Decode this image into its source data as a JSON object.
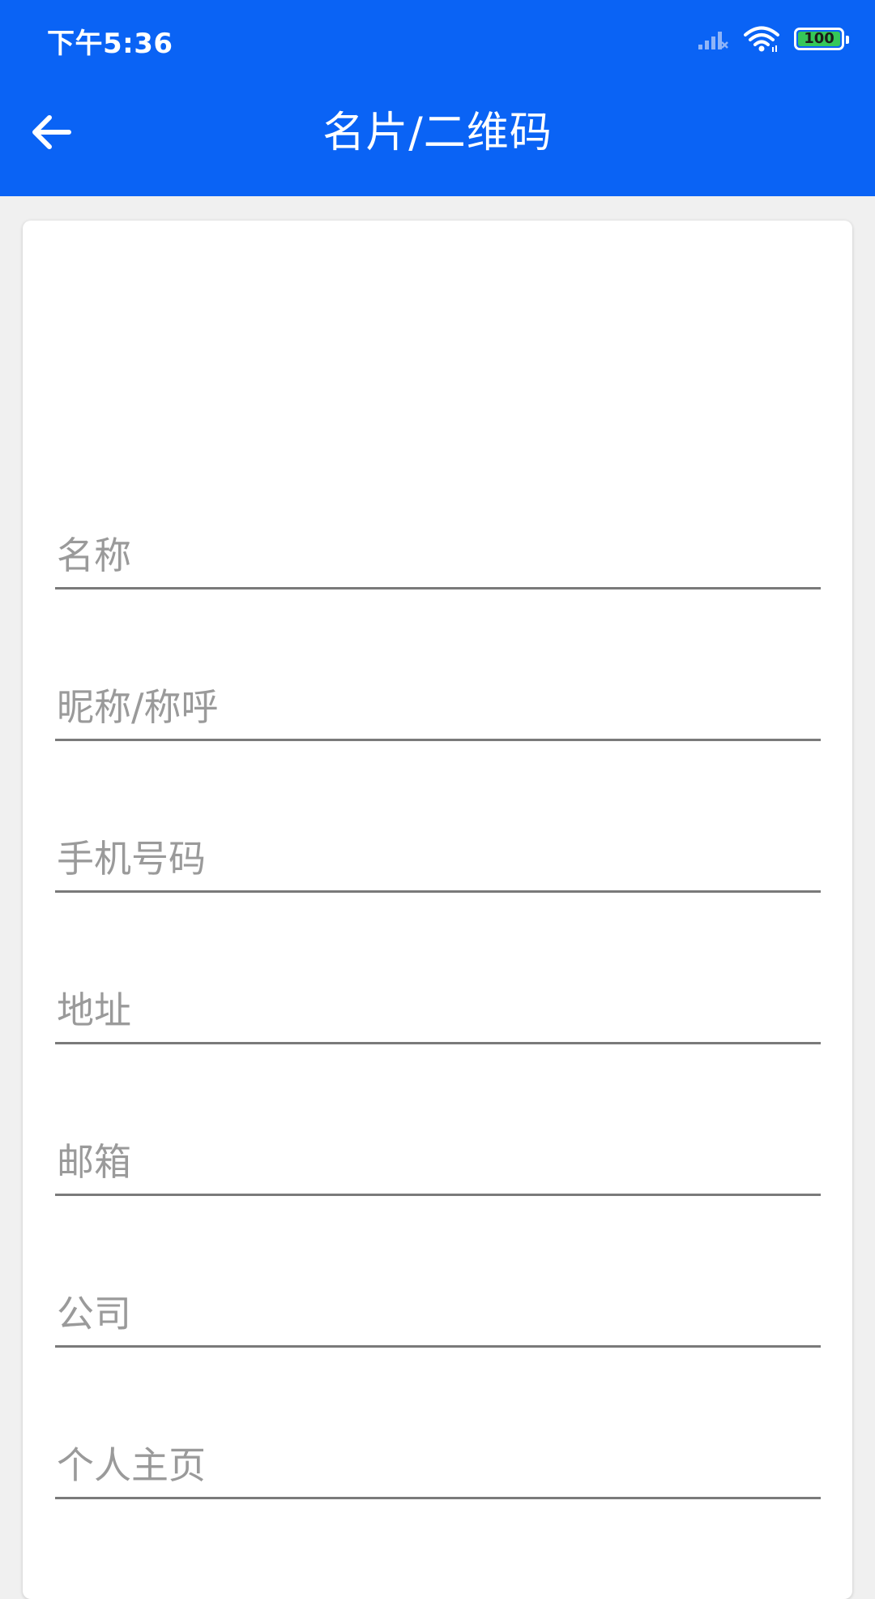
{
  "status_bar": {
    "time": "下午5:36",
    "battery_level": "100",
    "battery_color": "#35c759"
  },
  "app_bar": {
    "title": "名片/二维码",
    "back_icon": "arrow-left-icon",
    "background": "#0a63f5"
  },
  "form": {
    "fields": [
      {
        "placeholder": "名称",
        "value": ""
      },
      {
        "placeholder": "昵称/称呼",
        "value": ""
      },
      {
        "placeholder": "手机号码",
        "value": ""
      },
      {
        "placeholder": "地址",
        "value": ""
      },
      {
        "placeholder": "邮箱",
        "value": ""
      },
      {
        "placeholder": "公司",
        "value": ""
      },
      {
        "placeholder": "个人主页",
        "value": ""
      }
    ]
  }
}
